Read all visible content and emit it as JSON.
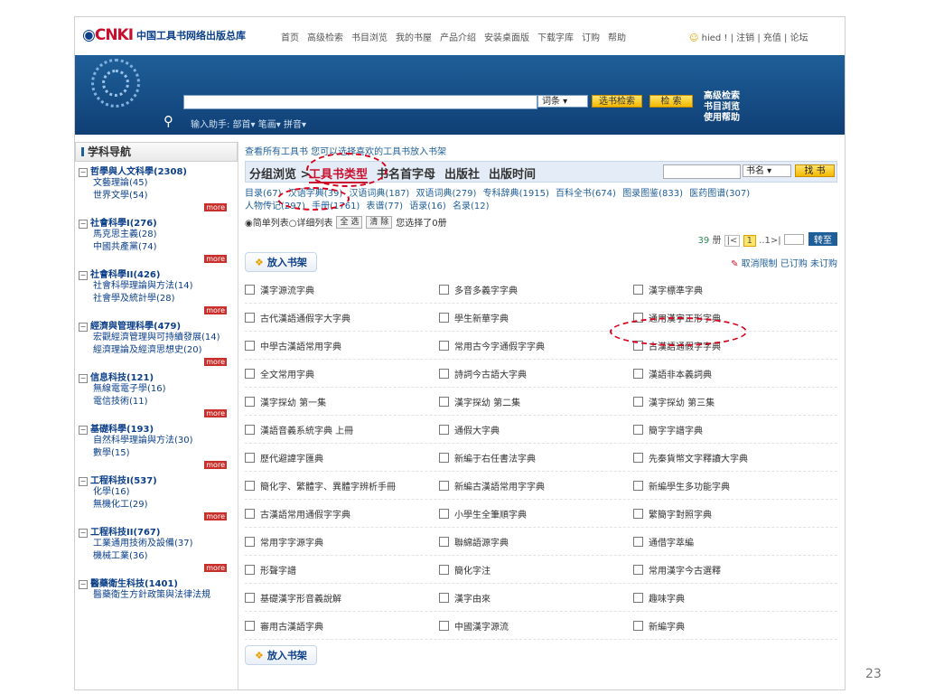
{
  "header": {
    "logo_mark": "CNKI",
    "logo_name": "中国工具书网络出版总库",
    "nav": [
      "首页",
      "高级检索",
      "书目浏览",
      "我的书屋",
      "产品介绍",
      "安装桌面版",
      "下载字库",
      "订购",
      "帮助"
    ],
    "user": "hied ! | 注销 | 充值 | 论坛"
  },
  "banner": {
    "search_value": "",
    "scope": "词条",
    "btn_select": "选书检索",
    "btn_search": "检 索",
    "helper": "输入助手: 部首▾ 笔画▾ 拼音▾",
    "links": [
      "高级检索",
      "书目浏览",
      "使用帮助"
    ]
  },
  "sidebar": {
    "title": "学科导航",
    "more": "more",
    "categories": [
      {
        "title": "哲學與人文科學(2308)",
        "subs": [
          "文藝理論(45)",
          "世界文學(54)"
        ]
      },
      {
        "title": "社會科學I(276)",
        "subs": [
          "馬克思主義(28)",
          "中國共產黨(74)"
        ]
      },
      {
        "title": "社會科學II(426)",
        "subs": [
          "社會科學理論與方法(14)",
          "社會學及統計學(28)"
        ]
      },
      {
        "title": "經濟與管理科學(479)",
        "subs": [
          "宏觀經濟管理與可持續發展(14)",
          "經濟理論及經濟思想史(20)"
        ]
      },
      {
        "title": "信息科技(121)",
        "subs": [
          "無線電電子學(16)",
          "電信技術(11)"
        ]
      },
      {
        "title": "基礎科學(193)",
        "subs": [
          "自然科學理論與方法(30)",
          "數學(15)"
        ]
      },
      {
        "title": "工程科技I(537)",
        "subs": [
          "化學(16)",
          "無機化工(29)"
        ]
      },
      {
        "title": "工程科技II(767)",
        "subs": [
          "工業通用技術及設備(37)",
          "機械工業(36)"
        ]
      },
      {
        "title": "醫藥衛生科技(1401)",
        "subs": [
          "醫藥衛生方針政策與法律法規"
        ]
      }
    ]
  },
  "main": {
    "hint": "查看所有工具书 您可以选择喜欢的工具书放入书架",
    "browse_label": "分组浏览 >",
    "tabs": [
      "工具书类型",
      "书名首字母",
      "出版社",
      "出版时间"
    ],
    "search_scope": "书名",
    "search_btn": "找 书",
    "filters": [
      "目录(67)",
      "汉语字典(39)",
      "汉语词典(187)",
      "双语词典(279)",
      "专科辞典(1915)",
      "百科全书(674)",
      "图录图鉴(833)",
      "医药图谱(307)",
      "人物传记(297)",
      "手册(1761)",
      "表谱(77)",
      "语录(16)",
      "名录(12)"
    ],
    "list_mode": "◉简单列表○详细列表",
    "select_all": "全 选",
    "clear": "清 除",
    "selected": "您选择了0册",
    "pager": {
      "count": "39",
      "unit": "册",
      "first": "|<",
      "page": "1",
      "rest": "..1>|",
      "go": "转至"
    },
    "shelf_btn": "放入书架",
    "legend": "取消限制 已订购 未订购",
    "books": [
      [
        "漢字源流字典",
        "多音多義字字典",
        "漢字標準字典"
      ],
      [
        "古代漢語通假字大字典",
        "學生新華字典",
        "通用漢字正形字典"
      ],
      [
        "中學古漢語常用字典",
        "常用古今字通假字字典",
        "古漢語通假字字典"
      ],
      [
        "全文常用字典",
        "詩詞今古語大字典",
        "漢語非本義詞典"
      ],
      [
        "漢字探幼 第一集",
        "漢字探幼 第二集",
        "漢字探幼 第三集"
      ],
      [
        "漢語音義系統字典 上冊",
        "通假大字典",
        "簡字字譜字典"
      ],
      [
        "歷代避諱字匯典",
        "新編于右任書法字典",
        "先秦貨幣文字釋讀大字典"
      ],
      [
        "簡化字、繁體字、異體字辨析手冊",
        "新編古漢語常用字字典",
        "新編學生多功能字典"
      ],
      [
        "古漢語常用通假字字典",
        "小學生全筆順字典",
        "繁簡字對照字典"
      ],
      [
        "常用字字源字典",
        "聯綿語源字典",
        "通借字萃編"
      ],
      [
        "形聲字譜",
        "簡化字注",
        "常用漢字今古選釋"
      ],
      [
        "基礎漢字形音義說解",
        "漢字由來",
        "趣味字典"
      ],
      [
        "審用古漢語字典",
        "中國漢字源流",
        "新編字典"
      ]
    ]
  },
  "slide_number": "23"
}
